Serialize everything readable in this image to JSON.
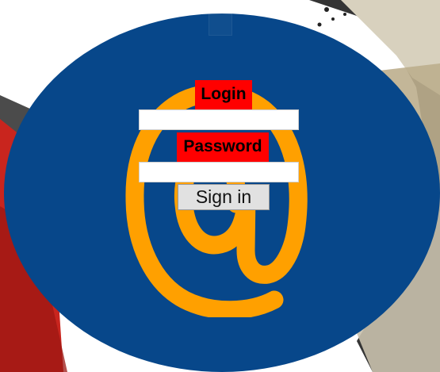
{
  "form": {
    "login_label": "Login",
    "login_value": "",
    "password_label": "Password",
    "password_value": "",
    "signin_label": "Sign in"
  },
  "decor": {
    "at_symbol": "@",
    "at_icon": "at-symbol-icon",
    "top_icon": "placeholder-icon"
  },
  "colors": {
    "oval_blue": "#07478a",
    "at_orange": "#ffa000",
    "label_red": "#ff0000",
    "button_gray": "#e1e1e1",
    "field_white": "#ffffff"
  }
}
